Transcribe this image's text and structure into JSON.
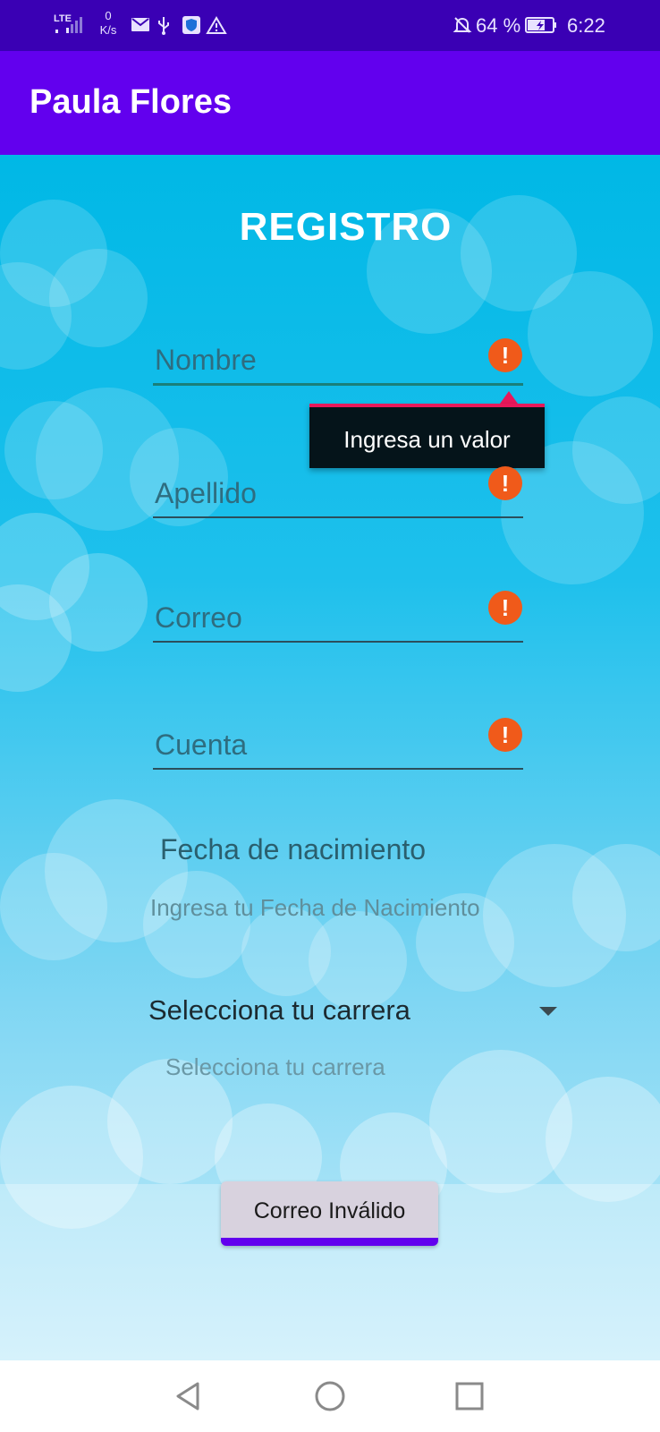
{
  "status_bar": {
    "network": "LTE",
    "speed_value": "0",
    "speed_unit": "K/s",
    "battery_percent": "64 %",
    "time": "6:22",
    "icons": [
      "signal-icon",
      "mail-icon",
      "usb-icon",
      "shield-icon",
      "warning-icon",
      "bell-off-icon",
      "battery-charging-icon"
    ]
  },
  "app_bar": {
    "title": "Paula Flores"
  },
  "form": {
    "title": "REGISTRO",
    "fields": [
      {
        "placeholder": "Nombre",
        "error": true
      },
      {
        "placeholder": "Apellido",
        "error": true
      },
      {
        "placeholder": "Correo",
        "error": true
      },
      {
        "placeholder": "Cuenta",
        "error": true
      }
    ],
    "error_glyph": "!",
    "error_tooltip": "Ingresa un valor",
    "dob_label": "Fecha de nacimiento",
    "dob_hint": "Ingresa tu Fecha de Nacimiento",
    "career_spinner_value": "Selecciona tu carrera",
    "career_hint": "Selecciona tu carrera",
    "submit_label": "Correo Inválido"
  },
  "colors": {
    "status_bar": "#3a00b4",
    "app_bar": "#6200ee",
    "error_icon": "#f05a1a",
    "tooltip_bg": "#05141a",
    "tooltip_accent": "#e8185a"
  },
  "nav_bar": {
    "buttons": [
      "back-icon",
      "home-icon",
      "recents-icon"
    ]
  }
}
